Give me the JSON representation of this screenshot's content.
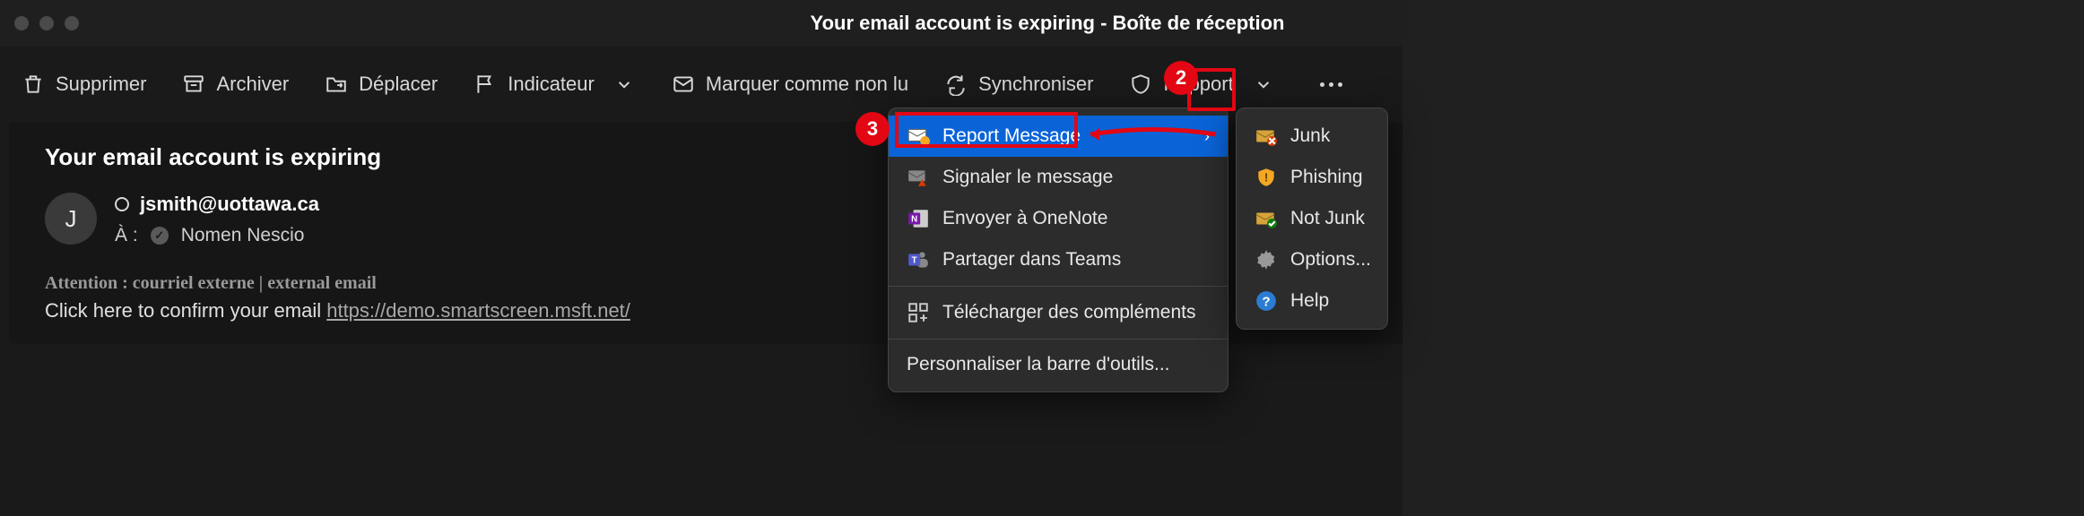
{
  "window": {
    "title": "Your email account is expiring - Boîte de réception"
  },
  "toolbar": {
    "delete": "Supprimer",
    "archive": "Archiver",
    "move": "Déplacer",
    "flag": "Indicateur",
    "unread": "Marquer comme non lu",
    "sync": "Synchroniser",
    "report": "Rapport"
  },
  "email": {
    "subject": "Your email account is expiring",
    "avatar_initial": "J",
    "from": "jsmith@uottawa.ca",
    "to_label": "À :",
    "to_name": "Nomen Nescio",
    "warning": "Attention : courriel externe | external email",
    "body_prefix": "Click here to confirm your email ",
    "body_link": "https://demo.smartscreen.msft.net/"
  },
  "menu_main": {
    "report_message": "Report Message",
    "signaler": "Signaler le message",
    "onenote": "Envoyer à OneNote",
    "teams": "Partager dans Teams",
    "addins": "Télécharger des compléments",
    "customize": "Personnaliser la barre d'outils..."
  },
  "menu_sub": {
    "junk": "Junk",
    "phishing": "Phishing",
    "not_junk": "Not Junk",
    "options": "Options...",
    "help": "Help"
  },
  "callouts": {
    "two": "2",
    "three": "3"
  }
}
